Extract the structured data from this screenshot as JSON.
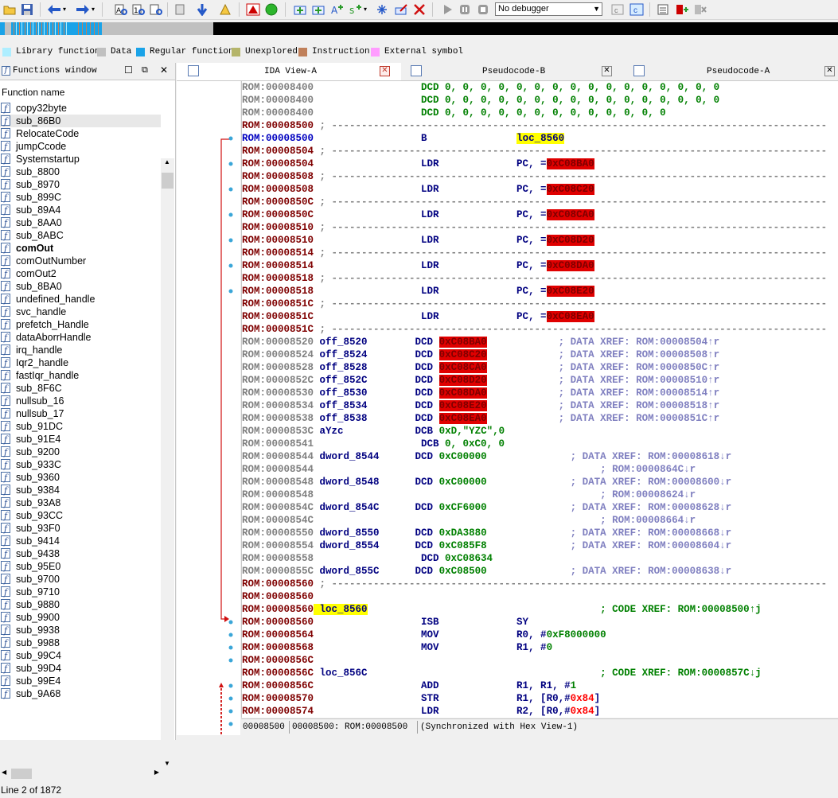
{
  "toolbar": {
    "debugger_label": "No debugger",
    "icons": [
      "open-icon",
      "save-icon",
      "back-icon",
      "forward-icon",
      "search-text-icon",
      "search-binary-icon",
      "search-immediate-icon",
      "search-icon",
      "jump-icon",
      "mark-icon",
      "warning-icon",
      "run-green-icon",
      "add-segment-icon",
      "add-struct-icon",
      "add-enum-icon",
      "add-func-icon",
      "edit-icon",
      "delete-icon",
      "play-icon",
      "pause-icon",
      "stop-icon",
      "step-icon",
      "step-over-icon",
      "graph-icon",
      "plugin-icon",
      "debug-icon"
    ]
  },
  "legend": [
    {
      "label": "Library function",
      "color": "#aeeeff"
    },
    {
      "label": "Data",
      "color": "#c0c0c0"
    },
    {
      "label": "Regular function",
      "color": "#1aa3e8"
    },
    {
      "label": "Unexplored",
      "color": "#b5b56a"
    },
    {
      "label": "Instruction",
      "color": "#c0805a"
    },
    {
      "label": "External symbol",
      "color": "#ff9cff"
    }
  ],
  "functions_window": {
    "title": "Functions window",
    "header": "Function name",
    "status": "Line 2 of 1872",
    "items": [
      {
        "name": "copy32byte"
      },
      {
        "name": "sub_86B0",
        "selected": true
      },
      {
        "name": "RelocateCode"
      },
      {
        "name": "jumpCcode"
      },
      {
        "name": "Systemstartup"
      },
      {
        "name": "sub_8800"
      },
      {
        "name": "sub_8970"
      },
      {
        "name": "sub_899C"
      },
      {
        "name": "sub_89A4"
      },
      {
        "name": "sub_8AA0"
      },
      {
        "name": "sub_8ABC"
      },
      {
        "name": "comOut",
        "bold": true
      },
      {
        "name": "comOutNumber"
      },
      {
        "name": "comOut2"
      },
      {
        "name": "sub_8BA0"
      },
      {
        "name": "undefined_handle"
      },
      {
        "name": "svc_handle"
      },
      {
        "name": "prefetch_Handle"
      },
      {
        "name": "dataAborrHandle"
      },
      {
        "name": "irq_handle"
      },
      {
        "name": "Iqr2_handle"
      },
      {
        "name": "fastIqr_handle"
      },
      {
        "name": "sub_8F6C"
      },
      {
        "name": "nullsub_16"
      },
      {
        "name": "nullsub_17"
      },
      {
        "name": "sub_91DC"
      },
      {
        "name": "sub_91E4"
      },
      {
        "name": "sub_9200"
      },
      {
        "name": "sub_933C"
      },
      {
        "name": "sub_9360"
      },
      {
        "name": "sub_9384"
      },
      {
        "name": "sub_93A8"
      },
      {
        "name": "sub_93CC"
      },
      {
        "name": "sub_93F0"
      },
      {
        "name": "sub_9414"
      },
      {
        "name": "sub_9438"
      },
      {
        "name": "sub_95E0"
      },
      {
        "name": "sub_9700"
      },
      {
        "name": "sub_9710"
      },
      {
        "name": "sub_9880"
      },
      {
        "name": "sub_9900"
      },
      {
        "name": "sub_9938"
      },
      {
        "name": "sub_9988"
      },
      {
        "name": "sub_99C4"
      },
      {
        "name": "sub_99D4"
      },
      {
        "name": "sub_99E4"
      },
      {
        "name": "sub_9A68"
      }
    ]
  },
  "tabs": [
    {
      "label": "IDA View-A",
      "active": true
    },
    {
      "label": "Pseudocode-B"
    },
    {
      "label": "Pseudocode-A"
    }
  ],
  "disasm": [
    {
      "addr": "ROM:00008400",
      "ac": "g",
      "parts": [
        [
          "c-mn",
          ""
        ],
        [
          "c-grn",
          "                  DCD 0, 0, 0, 0, 0, 0, 0, 0, 0, 0, 0, 0, 0, 0, 0, 0"
        ]
      ]
    },
    {
      "addr": "ROM:00008400",
      "ac": "g",
      "parts": [
        [
          "c-grn",
          "                  DCD 0, 0, 0, 0, 0, 0, 0, 0, 0, 0, 0, 0, 0, 0, 0, 0"
        ]
      ]
    },
    {
      "addr": "ROM:00008400",
      "ac": "g",
      "parts": [
        [
          "c-grn",
          "                  DCD 0, 0, 0, 0, 0, 0, 0, 0, 0, 0, 0, 0, 0"
        ]
      ]
    },
    {
      "addr": "ROM:00008500",
      "ac": "r",
      "sep": true
    },
    {
      "addr": "ROM:00008500",
      "ac": "b",
      "parts": [
        [
          "c-mn",
          "                  B               "
        ],
        [
          "c-name hl-y",
          "loc_8560"
        ]
      ]
    },
    {
      "addr": "ROM:00008504",
      "ac": "r",
      "sep": true
    },
    {
      "addr": "ROM:00008504",
      "ac": "r",
      "parts": [
        [
          "c-mn",
          "                  LDR             PC, ="
        ],
        [
          "hl-r",
          "0xC08BA0"
        ]
      ]
    },
    {
      "addr": "ROM:00008508",
      "ac": "r",
      "sep": true
    },
    {
      "addr": "ROM:00008508",
      "ac": "r",
      "parts": [
        [
          "c-mn",
          "                  LDR             PC, ="
        ],
        [
          "hl-r",
          "0xC08C20"
        ]
      ]
    },
    {
      "addr": "ROM:0000850C",
      "ac": "r",
      "sep": true
    },
    {
      "addr": "ROM:0000850C",
      "ac": "r",
      "parts": [
        [
          "c-mn",
          "                  LDR             PC, ="
        ],
        [
          "hl-r",
          "0xC08CA0"
        ]
      ]
    },
    {
      "addr": "ROM:00008510",
      "ac": "r",
      "sep": true
    },
    {
      "addr": "ROM:00008510",
      "ac": "r",
      "parts": [
        [
          "c-mn",
          "                  LDR             PC, ="
        ],
        [
          "hl-r",
          "0xC08D20"
        ]
      ]
    },
    {
      "addr": "ROM:00008514",
      "ac": "r",
      "sep": true
    },
    {
      "addr": "ROM:00008514",
      "ac": "r",
      "parts": [
        [
          "c-mn",
          "                  LDR             PC, ="
        ],
        [
          "hl-r",
          "0xC08DA0"
        ]
      ]
    },
    {
      "addr": "ROM:00008518",
      "ac": "r",
      "sep": true
    },
    {
      "addr": "ROM:00008518",
      "ac": "r",
      "parts": [
        [
          "c-mn",
          "                  LDR             PC, ="
        ],
        [
          "hl-r",
          "0xC08E20"
        ]
      ]
    },
    {
      "addr": "ROM:0000851C",
      "ac": "r",
      "sep": true
    },
    {
      "addr": "ROM:0000851C",
      "ac": "r",
      "parts": [
        [
          "c-mn",
          "                  LDR             PC, ="
        ],
        [
          "hl-r",
          "0xC08EA0"
        ]
      ]
    },
    {
      "addr": "ROM:0000851C",
      "ac": "r",
      "sep": true
    },
    {
      "addr": "ROM:00008520",
      "ac": "g",
      "parts": [
        [
          "c-name",
          " off_8520        "
        ],
        [
          "c-mn",
          "DCD "
        ],
        [
          "hl-r",
          "0xC08BA0"
        ],
        [
          "c-cmt",
          "            ; DATA XREF: ROM:00008504↑r"
        ]
      ]
    },
    {
      "addr": "ROM:00008524",
      "ac": "g",
      "parts": [
        [
          "c-name",
          " off_8524        "
        ],
        [
          "c-mn",
          "DCD "
        ],
        [
          "hl-r",
          "0xC08C20"
        ],
        [
          "c-cmt",
          "            ; DATA XREF: ROM:00008508↑r"
        ]
      ]
    },
    {
      "addr": "ROM:00008528",
      "ac": "g",
      "parts": [
        [
          "c-name",
          " off_8528        "
        ],
        [
          "c-mn",
          "DCD "
        ],
        [
          "hl-r",
          "0xC08CA0"
        ],
        [
          "c-cmt",
          "            ; DATA XREF: ROM:0000850C↑r"
        ]
      ]
    },
    {
      "addr": "ROM:0000852C",
      "ac": "g",
      "parts": [
        [
          "c-name",
          " off_852C        "
        ],
        [
          "c-mn",
          "DCD "
        ],
        [
          "hl-r",
          "0xC08D20"
        ],
        [
          "c-cmt",
          "            ; DATA XREF: ROM:00008510↑r"
        ]
      ]
    },
    {
      "addr": "ROM:00008530",
      "ac": "g",
      "parts": [
        [
          "c-name",
          " off_8530        "
        ],
        [
          "c-mn",
          "DCD "
        ],
        [
          "hl-r",
          "0xC08DA0"
        ],
        [
          "c-cmt",
          "            ; DATA XREF: ROM:00008514↑r"
        ]
      ]
    },
    {
      "addr": "ROM:00008534",
      "ac": "g",
      "parts": [
        [
          "c-name",
          " off_8534        "
        ],
        [
          "c-mn",
          "DCD "
        ],
        [
          "hl-r",
          "0xC08E20"
        ],
        [
          "c-cmt",
          "            ; DATA XREF: ROM:00008518↑r"
        ]
      ]
    },
    {
      "addr": "ROM:00008538",
      "ac": "g",
      "parts": [
        [
          "c-name",
          " off_8538        "
        ],
        [
          "c-mn",
          "DCD "
        ],
        [
          "hl-r",
          "0xC08EA0"
        ],
        [
          "c-cmt",
          "            ; DATA XREF: ROM:0000851C↑r"
        ]
      ]
    },
    {
      "addr": "ROM:0000853C",
      "ac": "g",
      "parts": [
        [
          "c-name",
          " aYzc            "
        ],
        [
          "c-mn",
          "DCB "
        ],
        [
          "c-grn",
          "0xD,\"YZC\",0"
        ]
      ]
    },
    {
      "addr": "ROM:00008541",
      "ac": "g",
      "parts": [
        [
          "c-mn",
          "                  DCB "
        ],
        [
          "c-grn",
          "0, 0xC0, 0"
        ]
      ]
    },
    {
      "addr": "ROM:00008544",
      "ac": "g",
      "parts": [
        [
          "c-name",
          " dword_8544      "
        ],
        [
          "c-mn",
          "DCD "
        ],
        [
          "c-grn",
          "0xC00000"
        ],
        [
          "c-cmt",
          "              ; DATA XREF: ROM:00008618↓r"
        ]
      ]
    },
    {
      "addr": "ROM:00008544",
      "ac": "g",
      "parts": [
        [
          "c-cmt",
          "                                                ; ROM:0000864C↓r"
        ]
      ]
    },
    {
      "addr": "ROM:00008548",
      "ac": "g",
      "parts": [
        [
          "c-name",
          " dword_8548      "
        ],
        [
          "c-mn",
          "DCD "
        ],
        [
          "c-grn",
          "0xC00000"
        ],
        [
          "c-cmt",
          "              ; DATA XREF: ROM:00008600↓r"
        ]
      ]
    },
    {
      "addr": "ROM:00008548",
      "ac": "g",
      "parts": [
        [
          "c-cmt",
          "                                                ; ROM:00008624↓r"
        ]
      ]
    },
    {
      "addr": "ROM:0000854C",
      "ac": "g",
      "parts": [
        [
          "c-name",
          " dword_854C      "
        ],
        [
          "c-mn",
          "DCD "
        ],
        [
          "c-grn",
          "0xCF6000"
        ],
        [
          "c-cmt",
          "              ; DATA XREF: ROM:00008628↓r"
        ]
      ]
    },
    {
      "addr": "ROM:0000854C",
      "ac": "g",
      "parts": [
        [
          "c-cmt",
          "                                                ; ROM:00008664↓r"
        ]
      ]
    },
    {
      "addr": "ROM:00008550",
      "ac": "g",
      "parts": [
        [
          "c-name",
          " dword_8550      "
        ],
        [
          "c-mn",
          "DCD "
        ],
        [
          "c-grn",
          "0xDA3880"
        ],
        [
          "c-cmt",
          "              ; DATA XREF: ROM:00008668↓r"
        ]
      ]
    },
    {
      "addr": "ROM:00008554",
      "ac": "g",
      "parts": [
        [
          "c-name",
          " dword_8554      "
        ],
        [
          "c-mn",
          "DCD "
        ],
        [
          "c-grn",
          "0xC085F8"
        ],
        [
          "c-cmt",
          "              ; DATA XREF: ROM:00008604↓r"
        ]
      ]
    },
    {
      "addr": "ROM:00008558",
      "ac": "g",
      "parts": [
        [
          "c-mn",
          "                  DCD "
        ],
        [
          "c-grn",
          "0xC08634"
        ]
      ]
    },
    {
      "addr": "ROM:0000855C",
      "ac": "g",
      "parts": [
        [
          "c-name",
          " dword_855C      "
        ],
        [
          "c-mn",
          "DCD "
        ],
        [
          "c-grn",
          "0xC08500"
        ],
        [
          "c-cmt",
          "              ; DATA XREF: ROM:00008638↓r"
        ]
      ]
    },
    {
      "addr": "ROM:00008560",
      "ac": "r",
      "sep": true
    },
    {
      "addr": "ROM:00008560",
      "ac": "r",
      "parts": []
    },
    {
      "addr": "ROM:00008560",
      "ac": "r",
      "parts": [
        [
          "c-name hl-y",
          " loc_8560"
        ],
        [
          "c-cmtg",
          "                                       ; CODE XREF: ROM:00008500↑j"
        ]
      ]
    },
    {
      "addr": "ROM:00008560",
      "ac": "r",
      "parts": [
        [
          "c-mn",
          "                  ISB             SY"
        ]
      ]
    },
    {
      "addr": "ROM:00008564",
      "ac": "r",
      "parts": [
        [
          "c-mn",
          "                  MOV             R0, #"
        ],
        [
          "c-grn",
          "0xF8000000"
        ]
      ]
    },
    {
      "addr": "ROM:00008568",
      "ac": "r",
      "parts": [
        [
          "c-mn",
          "                  MOV             R1, #"
        ],
        [
          "c-grn",
          "0"
        ]
      ]
    },
    {
      "addr": "ROM:0000856C",
      "ac": "r",
      "parts": []
    },
    {
      "addr": "ROM:0000856C",
      "ac": "r",
      "parts": [
        [
          "c-name",
          " loc_856C"
        ],
        [
          "c-cmtg",
          "                                       ; CODE XREF: ROM:0000857C↓j"
        ]
      ]
    },
    {
      "addr": "ROM:0000856C",
      "ac": "r",
      "parts": [
        [
          "c-mn",
          "                  ADD             R1, R1, #"
        ],
        [
          "c-grn",
          "1"
        ]
      ]
    },
    {
      "addr": "ROM:00008570",
      "ac": "r",
      "parts": [
        [
          "c-mn",
          "                  STR             R1, [R0,#"
        ],
        [
          "c-red",
          "0x84"
        ],
        [
          "c-mn",
          "]"
        ]
      ]
    },
    {
      "addr": "ROM:00008574",
      "ac": "r",
      "parts": [
        [
          "c-mn",
          "                  LDR             R2, [R0,#"
        ],
        [
          "c-red",
          "0x84"
        ],
        [
          "c-mn",
          "]"
        ]
      ]
    }
  ],
  "status": {
    "offset": "00008500",
    "location": "00008500: ROM:00008500",
    "message": "(Synchronized with Hex View-1)"
  }
}
